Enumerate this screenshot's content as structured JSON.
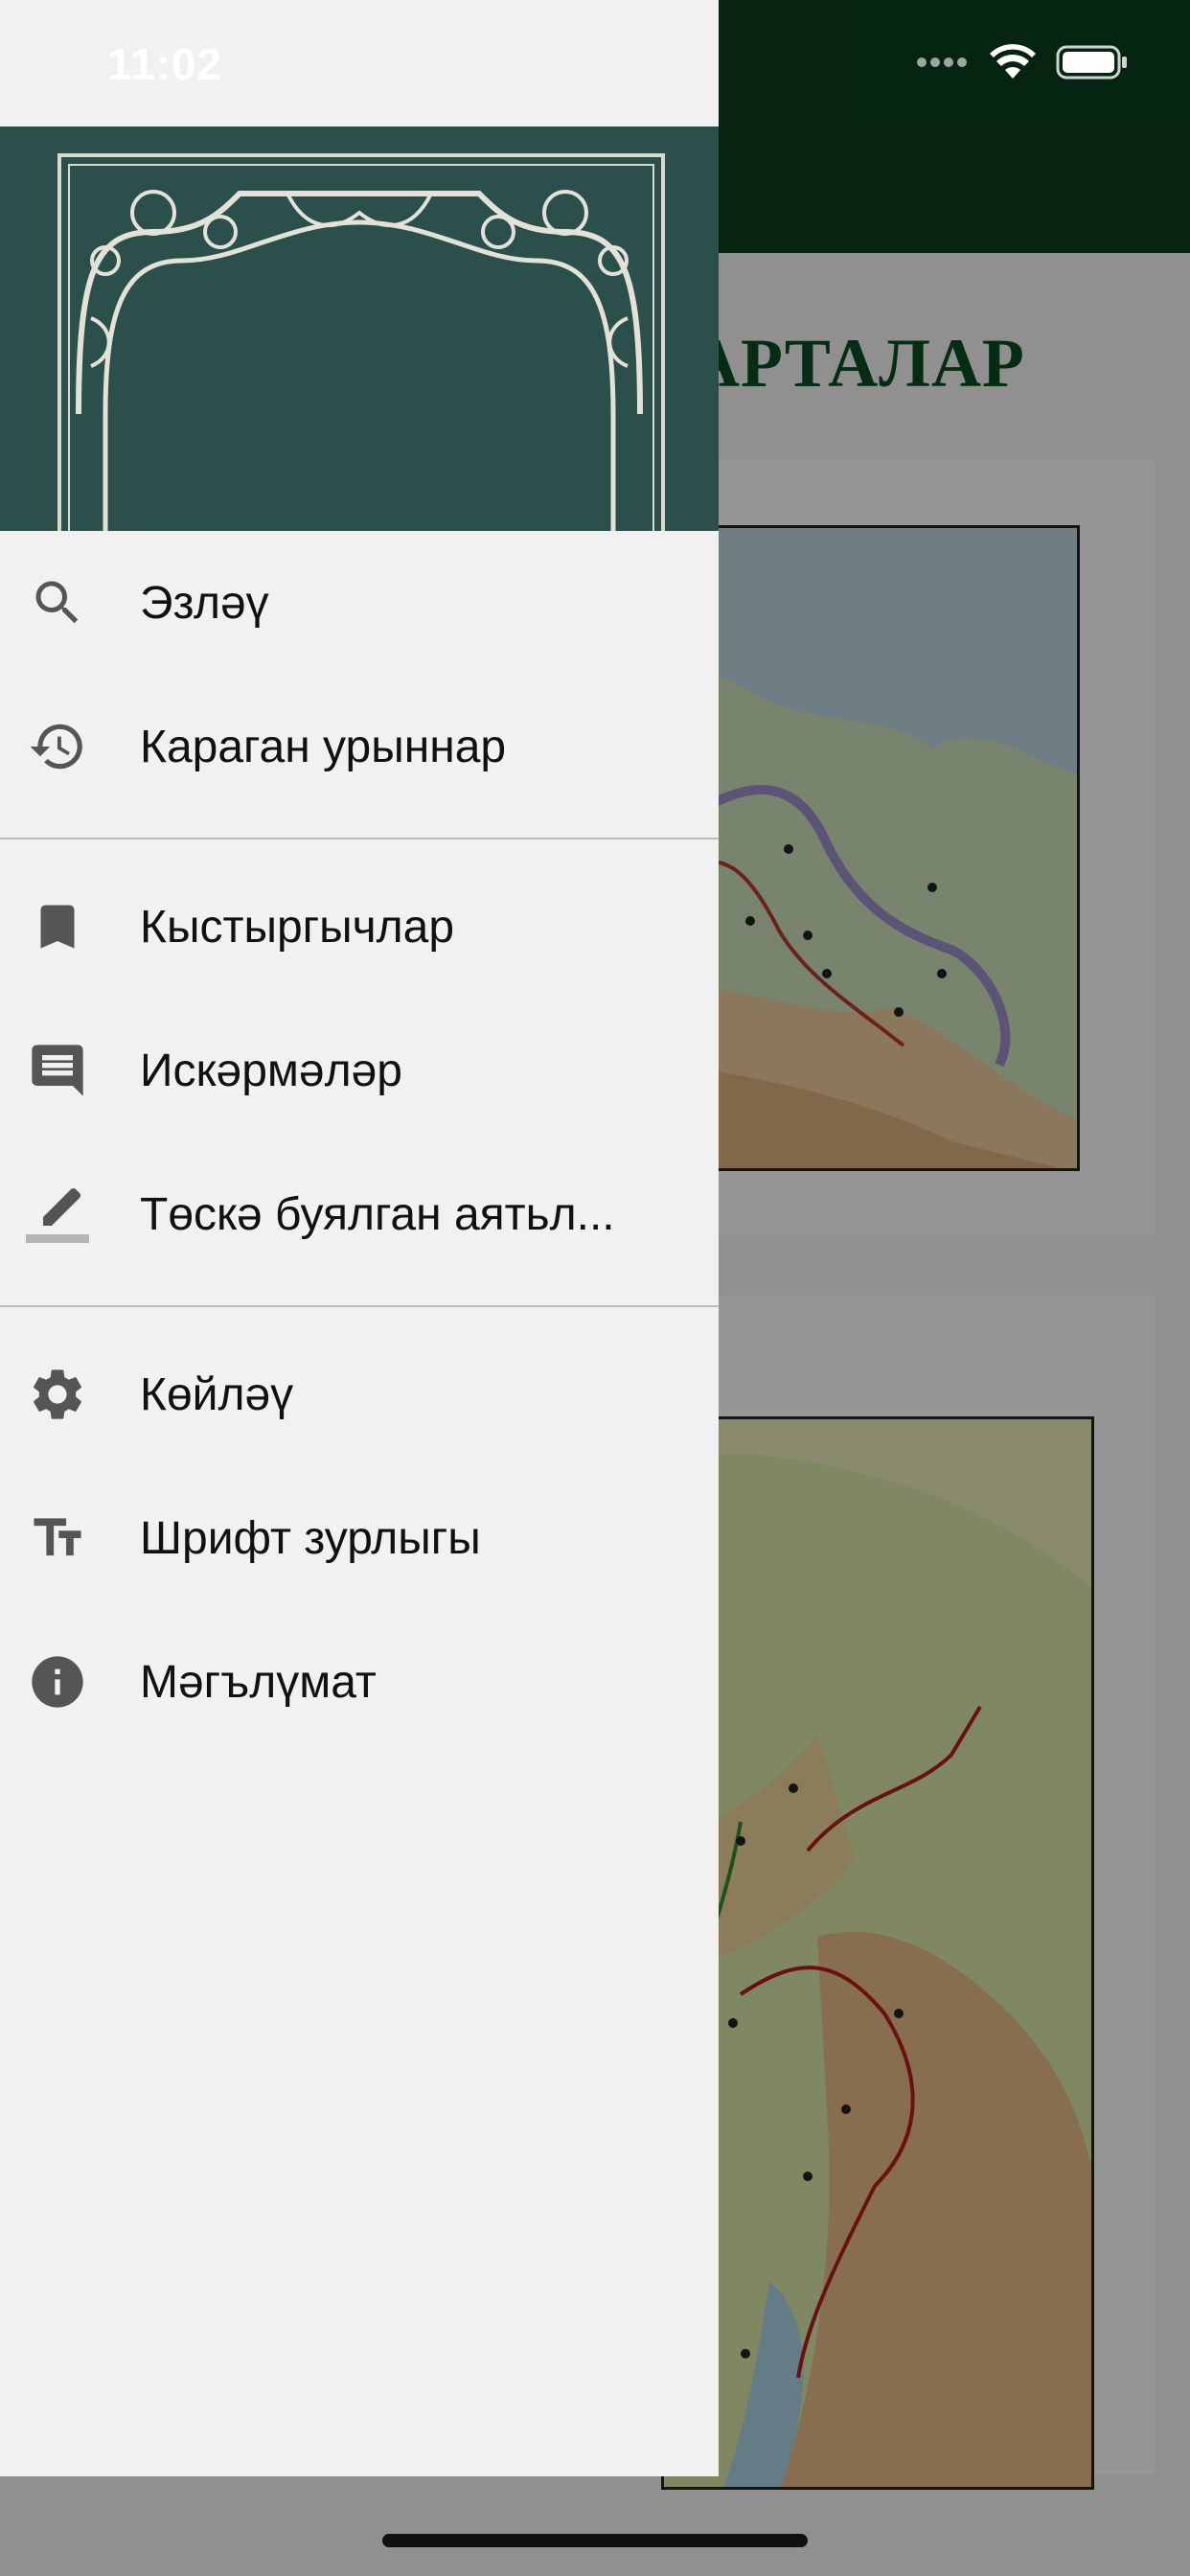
{
  "status_bar": {
    "time": "11:02"
  },
  "background": {
    "title": "АРТАЛАР"
  },
  "menu": {
    "group1": [
      {
        "label": "Эзләү",
        "icon": "search-icon"
      },
      {
        "label": "Караган урыннар",
        "icon": "history-icon"
      }
    ],
    "group2": [
      {
        "label": "Кыстыргычлар",
        "icon": "bookmark-icon"
      },
      {
        "label": "Искәрмәләр",
        "icon": "note-icon"
      },
      {
        "label": "Төскә буялган аятьл...",
        "icon": "highlight-pen-icon"
      }
    ],
    "group3": [
      {
        "label": "Көйләү",
        "icon": "gear-icon"
      },
      {
        "label": "Шрифт зурлыгы",
        "icon": "font-size-icon"
      },
      {
        "label": "Мәгълүмат",
        "icon": "info-icon"
      }
    ]
  },
  "colors": {
    "header": "#0b3d1e",
    "drawer": "#f1f1f1",
    "cover": "#2f5550",
    "icon": "#555555"
  }
}
